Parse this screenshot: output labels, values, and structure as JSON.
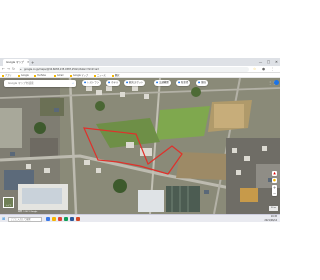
{
  "browser": {
    "tab_title": "Google マップ",
    "tab_close_icon": "close-icon",
    "url": "google.co.jp/maps/@34.6638,135.4587,254m/data=!3m1!1e3",
    "window_controls": [
      "—",
      "□",
      "✕"
    ]
  },
  "bookmarks": [
    "アプリ",
    "Google",
    "YouTube",
    "Gmail",
    "Google マップ",
    "ニュース",
    "翻訳"
  ],
  "map": {
    "search_placeholder": "Google マップを検索",
    "chips": [
      {
        "icon": "restaurant-icon",
        "label": "レストラン"
      },
      {
        "icon": "hotel-icon",
        "label": "ホテル"
      },
      {
        "icon": "attraction-icon",
        "label": "観光スポット"
      },
      {
        "icon": "transit-icon",
        "label": "交通機関"
      },
      {
        "icon": "parking-icon",
        "label": "駐車場"
      },
      {
        "icon": "pharmacy-icon",
        "label": "薬局"
      }
    ],
    "layer_label": "レイヤ",
    "scale_text": "20 m",
    "attribution": "画像 ©2021 Google",
    "highlight_color": "#e0302a"
  },
  "taskbar": {
    "search_text": "ここに入力して検索",
    "time": "10:45",
    "date": "2021/06/14"
  }
}
